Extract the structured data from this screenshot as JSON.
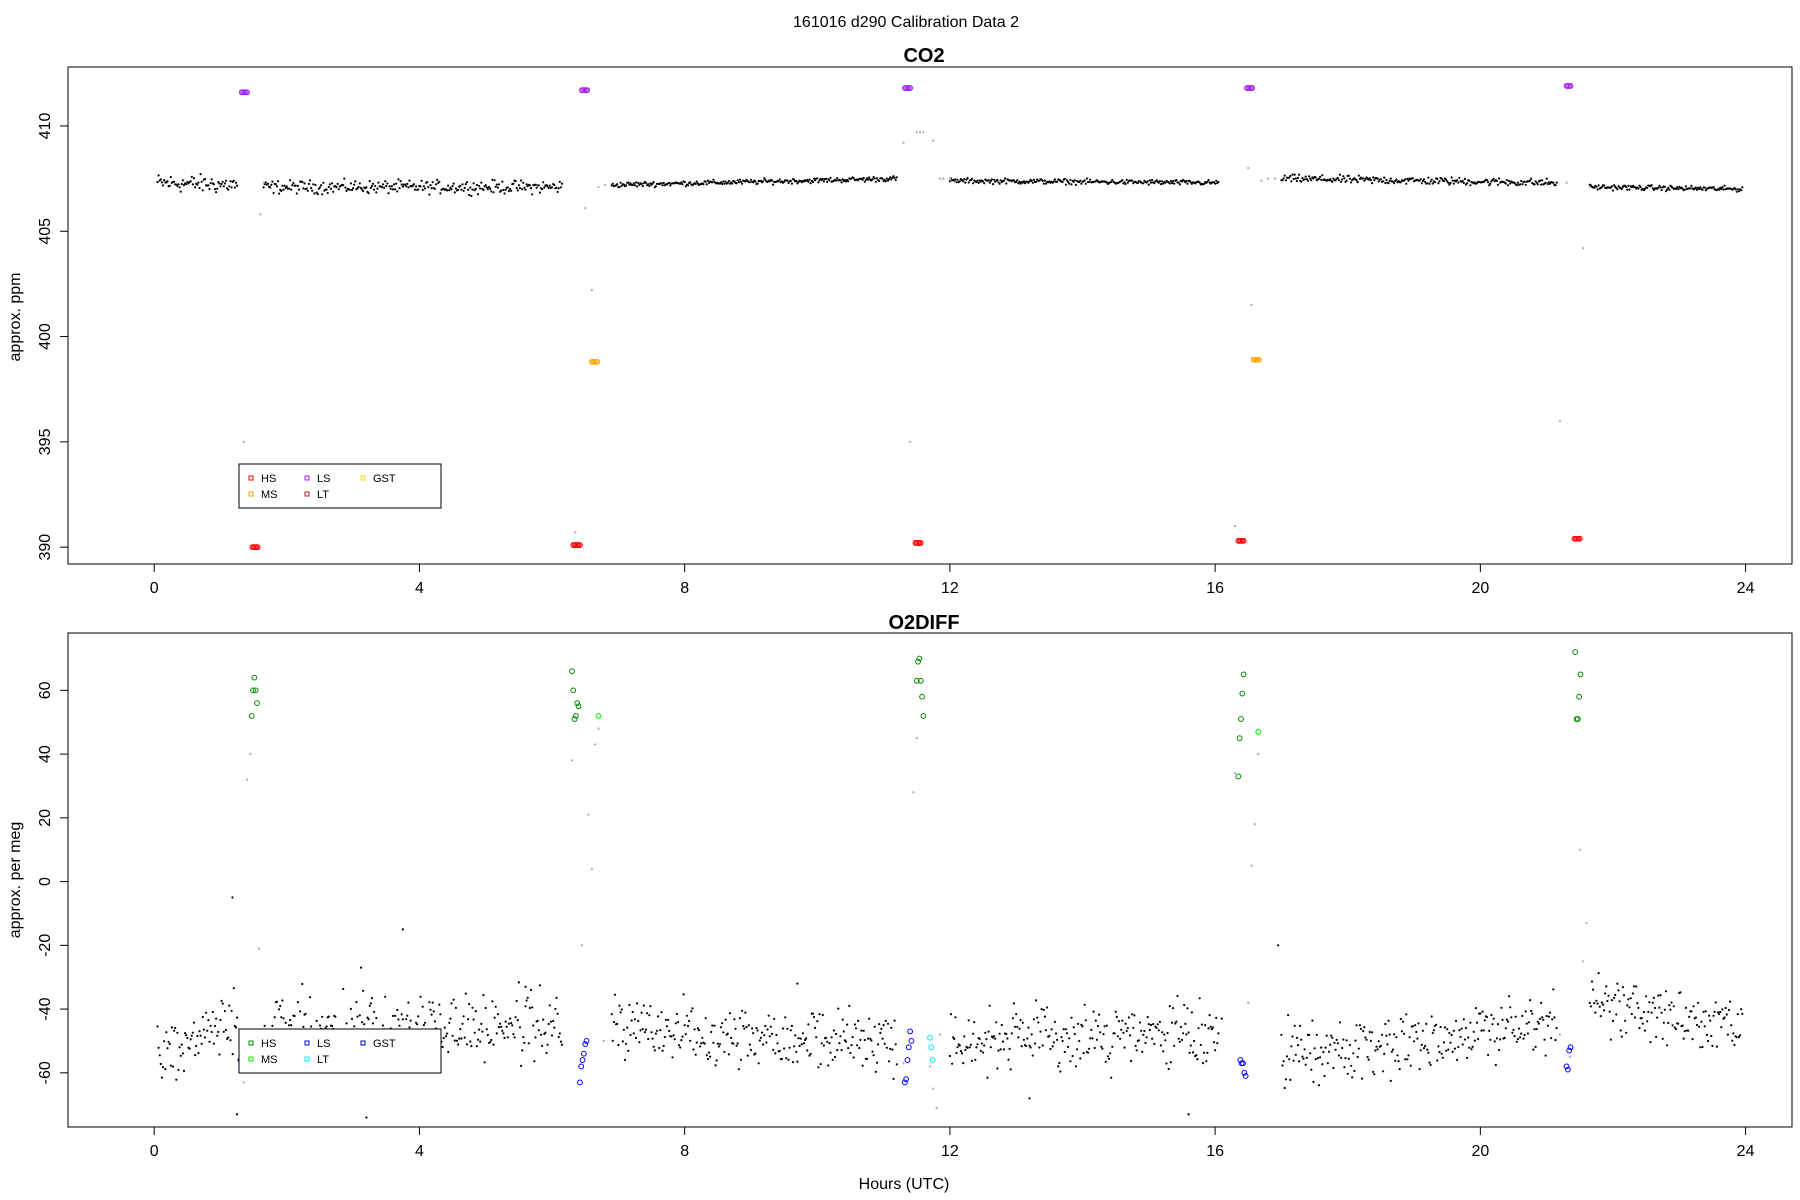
{
  "figure_title": "161016   d290   Calibration Data 2",
  "chart_data": [
    {
      "type": "scatter",
      "title": "CO2",
      "xlabel": "",
      "ylabel": "approx. ppm",
      "xlim": [
        -1.3,
        24.7
      ],
      "ylim": [
        389.2,
        412.8
      ],
      "xticks": [
        0,
        4,
        8,
        12,
        16,
        20,
        24
      ],
      "yticks": [
        390,
        395,
        400,
        405,
        410
      ],
      "grid": false,
      "legend_position": "bottom-left",
      "legend": [
        {
          "label": "HS",
          "color": "#ff0000"
        },
        {
          "label": "MS",
          "color": "#ffa500"
        },
        {
          "label": "LS",
          "color": "#a020f0"
        },
        {
          "label": "LT",
          "color": "#b22222"
        },
        {
          "label": "GST",
          "color": "#ffd700"
        }
      ],
      "ambient": {
        "color": "#000000",
        "segments": [
          {
            "x": [
              0.05,
              1.25
            ],
            "y": [
              407.3,
              407.2
            ],
            "noise": 0.35
          },
          {
            "x": [
              1.65,
              6.15
            ],
            "y": [
              407.1,
              407.1
            ],
            "noise": 0.25
          },
          {
            "x": [
              6.9,
              11.2
            ],
            "y": [
              407.2,
              407.5
            ],
            "noise": 0.1
          },
          {
            "x": [
              12.0,
              16.05
            ],
            "y": [
              407.4,
              407.3
            ],
            "noise": 0.1
          },
          {
            "x": [
              17.0,
              21.15
            ],
            "y": [
              407.5,
              407.3
            ],
            "noise": 0.15
          },
          {
            "x": [
              21.65,
              23.95
            ],
            "y": [
              407.1,
              407.0
            ],
            "noise": 0.1
          }
        ]
      },
      "transition": {
        "color": "#b3b3b3",
        "x": [
          1.35,
          1.6,
          1.65,
          6.35,
          6.5,
          6.6,
          6.7,
          6.8,
          11.3,
          11.4,
          11.5,
          11.55,
          11.6,
          11.75,
          11.85,
          11.9,
          12.0,
          16.3,
          16.5,
          16.55,
          16.7,
          16.8,
          16.9,
          21.2,
          21.3,
          21.55,
          21.65
        ],
        "y": [
          395,
          405.8,
          407.3,
          390.7,
          406.1,
          402.2,
          407.1,
          407.2,
          409.2,
          395.0,
          409.7,
          409.7,
          409.7,
          409.3,
          407.5,
          407.5,
          407.5,
          391.0,
          408.0,
          401.5,
          407.4,
          407.5,
          407.5,
          396.0,
          407.3,
          404.2,
          407.1
        ]
      },
      "calibrations": [
        {
          "name": "HS",
          "color": "#ff0000",
          "x": [
            1.48,
            1.5,
            1.52,
            1.54,
            1.56
          ],
          "y": [
            390.0,
            390.0,
            390.0,
            390.0,
            390.0
          ]
        },
        {
          "name": "HS",
          "color": "#ff0000",
          "x": [
            6.32,
            6.34,
            6.36,
            6.38,
            6.4,
            6.42
          ],
          "y": [
            390.1,
            390.1,
            390.1,
            390.1,
            390.1,
            390.1
          ]
        },
        {
          "name": "HS",
          "color": "#ff0000",
          "x": [
            11.48,
            11.5,
            11.52,
            11.54,
            11.56
          ],
          "y": [
            390.2,
            390.2,
            390.2,
            390.2,
            390.2
          ]
        },
        {
          "name": "HS",
          "color": "#ff0000",
          "x": [
            16.35,
            16.37,
            16.39,
            16.41,
            16.43
          ],
          "y": [
            390.3,
            390.3,
            390.3,
            390.3,
            390.3
          ]
        },
        {
          "name": "HS",
          "color": "#ff0000",
          "x": [
            21.42,
            21.44,
            21.46,
            21.48,
            21.5
          ],
          "y": [
            390.4,
            390.4,
            390.4,
            390.4,
            390.4
          ]
        },
        {
          "name": "MS",
          "color": "#ffa500",
          "x": [
            6.6,
            6.62,
            6.64,
            6.66,
            6.68
          ],
          "y": [
            398.8,
            398.8,
            398.8,
            398.8,
            398.8
          ]
        },
        {
          "name": "MS",
          "color": "#ffa500",
          "x": [
            16.58,
            16.6,
            16.62,
            16.64,
            16.66
          ],
          "y": [
            398.9,
            398.9,
            398.9,
            398.9,
            398.9
          ]
        },
        {
          "name": "LS",
          "color": "#a020f0",
          "x": [
            1.32,
            1.34,
            1.36,
            1.38,
            1.4
          ],
          "y": [
            411.6,
            411.6,
            411.6,
            411.6,
            411.6
          ]
        },
        {
          "name": "LS",
          "color": "#a020f0",
          "x": [
            6.45,
            6.47,
            6.49,
            6.51,
            6.53
          ],
          "y": [
            411.7,
            411.7,
            411.7,
            411.7,
            411.7
          ]
        },
        {
          "name": "LS",
          "color": "#a020f0",
          "x": [
            11.32,
            11.34,
            11.36,
            11.38,
            11.4
          ],
          "y": [
            411.8,
            411.8,
            411.8,
            411.8,
            411.8
          ]
        },
        {
          "name": "LS",
          "color": "#a020f0",
          "x": [
            16.48,
            16.5,
            16.52,
            16.54,
            16.56
          ],
          "y": [
            411.8,
            411.8,
            411.8,
            411.8,
            411.8
          ]
        },
        {
          "name": "LS",
          "color": "#a020f0",
          "x": [
            21.3,
            21.32,
            21.34,
            21.36
          ],
          "y": [
            411.9,
            411.9,
            411.9,
            411.9
          ]
        }
      ]
    },
    {
      "type": "scatter",
      "title": "O2DIFF",
      "xlabel": "Hours (UTC)",
      "ylabel": "approx. per meg",
      "xlim": [
        -1.3,
        24.7
      ],
      "ylim": [
        -77,
        78
      ],
      "xticks": [
        0,
        4,
        8,
        12,
        16,
        20,
        24
      ],
      "yticks": [
        -60,
        -40,
        -20,
        0,
        20,
        40,
        60
      ],
      "grid": false,
      "legend_position": "bottom-left",
      "legend": [
        {
          "label": "HS",
          "color": "#008b00"
        },
        {
          "label": "MS",
          "color": "#00ee00"
        },
        {
          "label": "LS",
          "color": "#0000ff"
        },
        {
          "label": "LT",
          "color": "#00eeee"
        },
        {
          "label": "GST",
          "color": "#0000cd"
        }
      ],
      "ambient": {
        "color": "#000000",
        "segments": [
          {
            "x": [
              0.05,
              1.25
            ],
            "y": [
              -54,
              -44
            ],
            "noise": 8
          },
          {
            "x": [
              1.65,
              6.15
            ],
            "y": [
              -46,
              -45
            ],
            "noise": 8
          },
          {
            "x": [
              6.9,
              11.2
            ],
            "y": [
              -46,
              -50
            ],
            "noise": 8
          },
          {
            "x": [
              12.0,
              16.05
            ],
            "y": [
              -50,
              -48
            ],
            "noise": 8
          },
          {
            "x": [
              17.0,
              21.15
            ],
            "y": [
              -55,
              -44
            ],
            "noise": 8
          },
          {
            "x": [
              21.65,
              23.95
            ],
            "y": [
              -38,
              -47
            ],
            "noise": 7
          }
        ],
        "outliers": {
          "x": [
            1.18,
            1.25,
            3.2,
            3.12,
            3.75,
            5.6,
            9.7,
            13.2,
            15.6,
            16.95,
            16.1
          ],
          "y": [
            -5,
            -73,
            -74,
            -27,
            -15,
            -33,
            -32,
            -68,
            -73,
            -20,
            -43
          ]
        }
      },
      "transition": {
        "color": "#b3b3b3",
        "x": [
          1.35,
          1.4,
          1.45,
          1.58,
          6.3,
          6.45,
          6.55,
          6.6,
          6.65,
          6.7,
          6.78,
          11.3,
          11.45,
          11.5,
          11.7,
          11.75,
          11.8,
          11.85,
          16.3,
          16.5,
          16.55,
          16.6,
          16.65,
          21.2,
          21.35,
          21.5,
          21.55,
          21.6
        ],
        "y": [
          -63,
          32,
          40,
          -21,
          38,
          -20,
          21,
          4,
          43,
          48,
          -50,
          -57,
          28,
          45,
          -58,
          -65,
          -71,
          -48,
          34,
          -38,
          5,
          18,
          40,
          -48,
          -55,
          10,
          -25,
          -13
        ],
        "outliers": {
          "x": [],
          "y": []
        }
      },
      "calibrations": [
        {
          "name": "HS",
          "color": "#008b00",
          "x": [
            1.47,
            1.49,
            1.51,
            1.53,
            1.55
          ],
          "y": [
            52,
            60,
            64,
            60,
            56
          ]
        },
        {
          "name": "HS",
          "color": "#008b00",
          "x": [
            6.3,
            6.32,
            6.34,
            6.36,
            6.38,
            6.4
          ],
          "y": [
            66,
            60,
            51,
            52,
            56,
            55
          ]
        },
        {
          "name": "HS",
          "color": "#008b00",
          "x": [
            11.5,
            11.52,
            11.54,
            11.56,
            11.58,
            11.6
          ],
          "y": [
            63,
            69,
            70,
            63,
            58,
            52
          ]
        },
        {
          "name": "HS",
          "color": "#008b00",
          "x": [
            16.35,
            16.37,
            16.39,
            16.41,
            16.43
          ],
          "y": [
            33,
            45,
            51,
            59,
            65
          ]
        },
        {
          "name": "HS",
          "color": "#008b00",
          "x": [
            21.43,
            21.45,
            21.47,
            21.49,
            21.51
          ],
          "y": [
            72,
            51,
            51,
            58,
            65
          ]
        },
        {
          "name": "MS",
          "color": "#00ee00",
          "x": [
            6.7,
            16.65
          ],
          "y": [
            52,
            47
          ]
        },
        {
          "name": "LS",
          "color": "#0000ff",
          "x": [
            1.3,
            1.32,
            1.34,
            1.36,
            1.38
          ],
          "y": [
            -56,
            -58,
            -59,
            -59,
            -59
          ]
        },
        {
          "name": "LS",
          "color": "#0000ff",
          "x": [
            6.42,
            6.44,
            6.46,
            6.48,
            6.5,
            6.52
          ],
          "y": [
            -63,
            -58,
            -56,
            -54,
            -51,
            -50
          ]
        },
        {
          "name": "LS",
          "color": "#0000ff",
          "x": [
            11.32,
            11.34,
            11.36,
            11.38,
            11.4,
            11.42
          ],
          "y": [
            -63,
            -62,
            -56,
            -52,
            -47,
            -50
          ]
        },
        {
          "name": "LS",
          "color": "#0000ff",
          "x": [
            16.38,
            16.4,
            16.42,
            16.44,
            16.46
          ],
          "y": [
            -56,
            -57,
            -57,
            -60,
            -61
          ]
        },
        {
          "name": "LS",
          "color": "#0000ff",
          "x": [
            21.3,
            21.32,
            21.34,
            21.36
          ],
          "y": [
            -58,
            -59,
            -53,
            -52
          ]
        },
        {
          "name": "LT",
          "color": "#00eeee",
          "x": [
            11.7,
            11.72,
            11.74
          ],
          "y": [
            -49,
            -52,
            -56
          ]
        }
      ]
    }
  ]
}
